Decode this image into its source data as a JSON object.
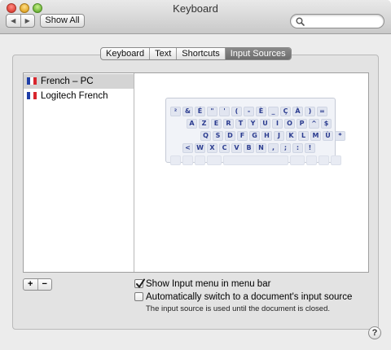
{
  "window": {
    "title": "Keyboard"
  },
  "toolbar": {
    "back_glyph": "◀",
    "forward_glyph": "▶",
    "show_all_label": "Show All",
    "search_placeholder": ""
  },
  "tabs": [
    {
      "label": "Keyboard",
      "active": false
    },
    {
      "label": "Text",
      "active": false
    },
    {
      "label": "Shortcuts",
      "active": false
    },
    {
      "label": "Input Sources",
      "active": true
    }
  ],
  "sources": [
    {
      "label": "French – PC",
      "selected": true,
      "flag": [
        "#1f3fa8",
        "#ffffff",
        "#d8262d"
      ]
    },
    {
      "label": "Logitech French",
      "selected": false,
      "flag": [
        "#1f3fa8",
        "#ffffff",
        "#d8262d"
      ]
    }
  ],
  "keyboard_rows": [
    [
      "²",
      "&",
      "É",
      "\"",
      "'",
      "(",
      "-",
      "È",
      "_",
      "Ç",
      "À",
      ")",
      "="
    ],
    [
      "A",
      "Z",
      "E",
      "R",
      "T",
      "Y",
      "U",
      "I",
      "O",
      "P",
      "^",
      "$"
    ],
    [
      "Q",
      "S",
      "D",
      "F",
      "G",
      "H",
      "J",
      "K",
      "L",
      "M",
      "Ù",
      "*"
    ],
    [
      "<",
      "W",
      "X",
      "C",
      "V",
      "B",
      "N",
      ",",
      ";",
      ":",
      "!"
    ]
  ],
  "list_buttons": {
    "add": "+",
    "remove": "−"
  },
  "options": {
    "show_menu": {
      "label": "Show Input menu in menu bar",
      "checked": true
    },
    "auto_switch": {
      "label": "Automatically switch to a document's input source",
      "checked": false
    },
    "note": "The input source is used until the document is closed."
  },
  "help_label": "?"
}
